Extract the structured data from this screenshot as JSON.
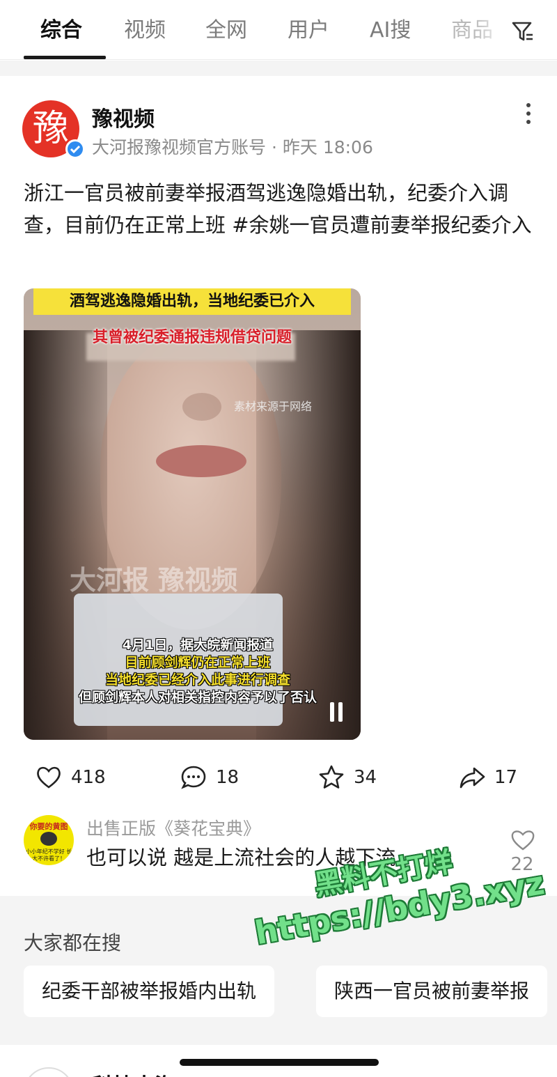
{
  "tabs": {
    "items": [
      {
        "label": "综合"
      },
      {
        "label": "视频"
      },
      {
        "label": "全网"
      },
      {
        "label": "用户"
      },
      {
        "label": "AI搜"
      },
      {
        "label": "商品"
      }
    ],
    "active_index": 0
  },
  "post": {
    "avatar_glyph": "豫",
    "author": "豫视频",
    "account_desc": "大河报豫视频官方账号",
    "separator": "·",
    "time": "昨天 18:06",
    "text": "浙江一官员被前妻举报酒驾逃逸隐婚出轨，纪委介入调查，目前仍在正常上班 #余姚一官员遭前妻举报纪委介入",
    "video": {
      "banner_top": "酒驾逃逸隐婚出轨，当地纪委已介入",
      "banner_sub": "其曾被纪委通报违规借贷问题",
      "source_note": "素材来源于网络",
      "watermark": "大河报 豫视频",
      "subtitles": [
        {
          "text": "4月1日，据大皖新闻报道",
          "color": "white"
        },
        {
          "text": "目前顾剑辉仍在正常上班",
          "color": "yellow"
        },
        {
          "text": "当地纪委已经介入此事进行调查",
          "color": "yellow"
        },
        {
          "text": "但顾剑辉本人对相关指控内容予以了否认",
          "color": "white"
        }
      ]
    },
    "actions": {
      "likes": "418",
      "comments": "18",
      "favorites": "34",
      "shares": "17"
    }
  },
  "comment": {
    "avatar_top": "你要的黄图",
    "avatar_bottom": "小小年纪不学好 长大不许看了！",
    "name": "出售正版《葵花宝典》",
    "text": "也可以说 越是上流社会的人越下流",
    "likes": "22"
  },
  "suggestions": {
    "title": "大家都在搜",
    "items": [
      {
        "label": "纪委干部被举报婚内出轨"
      },
      {
        "label": "陕西一官员被前妻举报"
      }
    ]
  },
  "overlay_watermark": {
    "line1": "黑料不打烊",
    "line2": "https://bdy3.xyz"
  },
  "next_post": {
    "name": "科技大海"
  },
  "colors": {
    "accent_red": "#e43226",
    "verified_blue": "#2f8cf0",
    "banner_yellow": "#f6e13a",
    "watermark_green": "#72e08a"
  }
}
